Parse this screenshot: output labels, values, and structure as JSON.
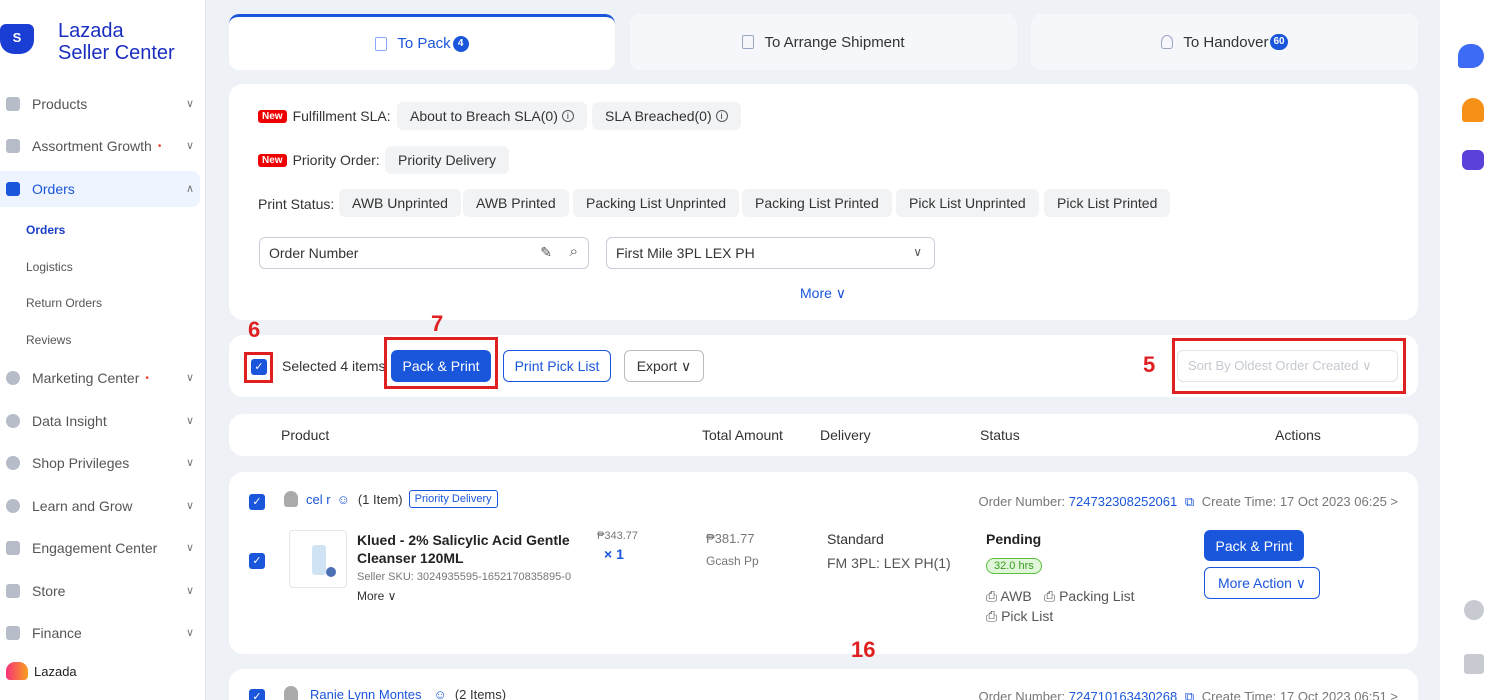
{
  "brand": {
    "logo_letter": "S",
    "title": "Lazada",
    "subtitle": "Seller Center"
  },
  "sidebar": {
    "items": [
      {
        "label": "Products"
      },
      {
        "label": "Assortment Growth",
        "dot": "•"
      },
      {
        "label": "Orders"
      },
      {
        "label": "Marketing Center",
        "dot": "•"
      },
      {
        "label": "Data Insight"
      },
      {
        "label": "Shop Privileges"
      },
      {
        "label": "Learn and Grow"
      },
      {
        "label": "Engagement Center"
      },
      {
        "label": "Store"
      },
      {
        "label": "Finance"
      }
    ],
    "sub_items": [
      "Orders",
      "Logistics",
      "Return Orders",
      "Reviews"
    ],
    "footer": "Lazada"
  },
  "tabs": [
    {
      "label": "To Pack",
      "count": "4"
    },
    {
      "label": "To Arrange Shipment",
      "count": ""
    },
    {
      "label": "To Handover",
      "count": "60"
    }
  ],
  "filters": {
    "new_tag": "New",
    "sla_label": "Fulfillment SLA:",
    "sla_about": "About to Breach SLA(0)",
    "sla_breached": "SLA Breached(0)",
    "info": "i",
    "priority_label": "Priority Order:",
    "priority_delivery": "Priority Delivery",
    "print_label": "Print Status:",
    "print_options": [
      "AWB Unprinted",
      "AWB Printed",
      "Packing List Unprinted",
      "Packing List Printed",
      "Pick List Unprinted",
      "Pick List Printed"
    ],
    "order_number_placeholder": "Order Number",
    "first_mile": "First Mile 3PL  LEX PH",
    "more": "More ∨"
  },
  "toolbar": {
    "selected": "Selected 4 items",
    "pack_print": "Pack & Print",
    "print_pick_list": "Print Pick List",
    "export": "Export ∨",
    "sort": "Sort By  Oldest Order Created  ∨"
  },
  "annotations": [
    "6",
    "7",
    "5",
    "16"
  ],
  "table_headers": [
    "Product",
    "Total Amount",
    "Delivery",
    "Status",
    "Actions"
  ],
  "orders": [
    {
      "customer": "cel r",
      "items": "(1 Item)",
      "priority": "Priority Delivery",
      "order_number_label": "Order Number:",
      "order_number": "724732308252061",
      "create_time": "Create Time: 17 Oct 2023 06:25 >",
      "product_name_1": "Klued - 2% Salicylic Acid Gentle",
      "product_name_2": "Cleanser 120ML",
      "sku": "Seller SKU: 3024935595-1652170835895-0",
      "more": "More ∨",
      "unit_price": "₱343.77",
      "qty": "× 1",
      "total": "₱381.77",
      "payment": "Gcash Pp",
      "delivery": "Standard",
      "delivery_sub": "FM 3PL: LEX PH(1)",
      "status": "Pending",
      "hours": "32.0 hrs",
      "awb": "⎙ AWB",
      "packing": "⎙ Packing List",
      "pick": "⎙ Pick List",
      "action_primary": "Pack & Print",
      "action_more": "More Action ∨"
    },
    {
      "customer": "Ranie Lynn Montes",
      "items": "(2 Items)",
      "order_number_label": "Order Number:",
      "order_number": "724710163430268",
      "create_time": "Create Time: 17 Oct 2023 06:51 >"
    }
  ]
}
